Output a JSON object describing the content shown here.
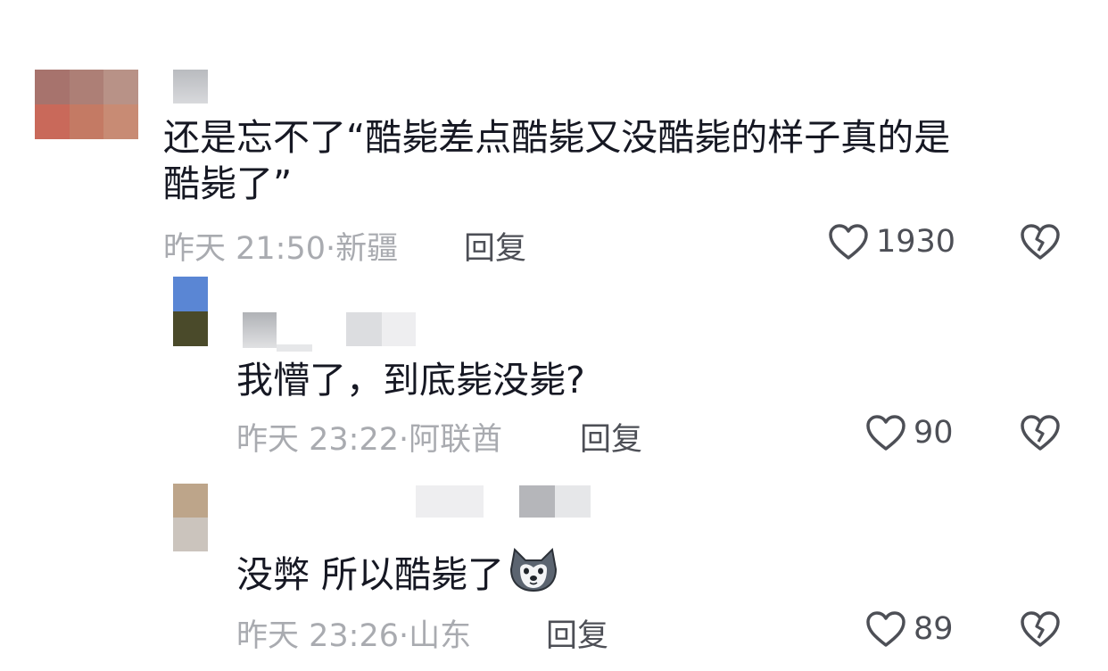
{
  "comments": [
    {
      "text_line1": "还是忘不了“酷毙差点酷毙又没酷毙的样子真的是",
      "text_line2": "酷毙了”",
      "time": "昨天 21:50",
      "location": "新疆",
      "reply_label": "回复",
      "likes": "1930",
      "icons": {
        "like": "heart-outline-icon",
        "dislike": "broken-heart-icon"
      }
    }
  ],
  "replies": [
    {
      "text": "我懵了，到底毙没毙?",
      "time": "昨天 23:22",
      "location": "阿联酋",
      "reply_label": "回复",
      "likes": "90"
    },
    {
      "text": "没弊 所以酷毙了",
      "emoji": "husky-face-emoji",
      "time": "昨天 23:26",
      "location": "山东",
      "reply_label": "回复",
      "likes": "89"
    }
  ],
  "separator": "·",
  "colors": {
    "text": "#161823",
    "meta": "#a9abb0",
    "action": "#4d4f56"
  }
}
